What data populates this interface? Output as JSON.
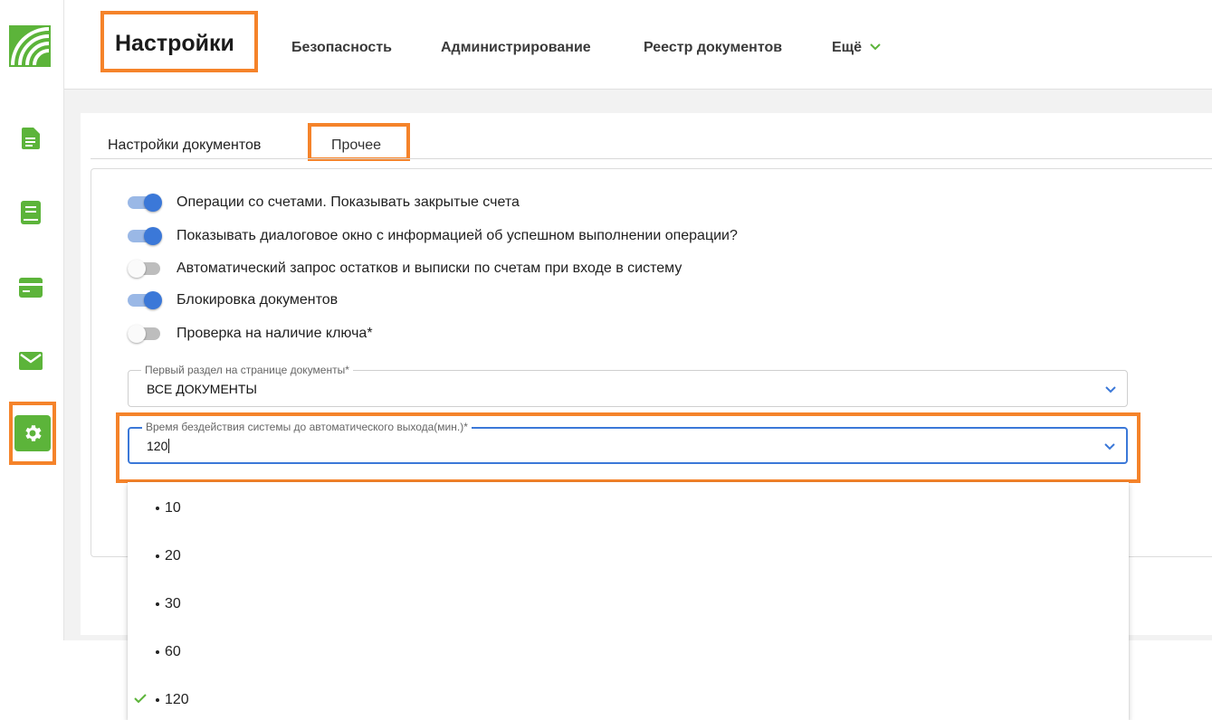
{
  "colors": {
    "brand_green": "#5cb43a",
    "accent_blue": "#3b78d8",
    "highlight_orange": "#f5832a"
  },
  "sidebar": {
    "items": [
      {
        "icon": "document-icon"
      },
      {
        "icon": "book-icon"
      },
      {
        "icon": "card-icon"
      },
      {
        "icon": "mail-icon"
      },
      {
        "icon": "gear-icon",
        "active": true
      }
    ]
  },
  "header": {
    "title": "Настройки",
    "links": [
      "Безопасность",
      "Администрирование",
      "Реестр документов"
    ],
    "more": "Ещё"
  },
  "tabs": [
    {
      "label": "Настройки документов"
    },
    {
      "label": "Прочее",
      "active": true
    }
  ],
  "toggles": [
    {
      "label": "Операции со счетами. Показывать закрытые счета",
      "on": true
    },
    {
      "label": "Показывать диалоговое окно с информацией об успешном выполнении операции?",
      "on": true
    },
    {
      "label": "Автоматический запрос остатков и выписки по счетам при входе в систему",
      "on": false
    },
    {
      "label": "Блокировка документов",
      "on": true
    },
    {
      "label": "Проверка на наличие ключа*",
      "on": false
    }
  ],
  "first_section": {
    "label": "Первый раздел на странице документы*",
    "value": "ВСЕ ДОКУМЕНТЫ"
  },
  "idle_timeout": {
    "label": "Время бездействия системы до автоматического выхода(мин.)*",
    "value": "120",
    "options": [
      "10",
      "20",
      "30",
      "60",
      "120"
    ],
    "selected": "120"
  }
}
